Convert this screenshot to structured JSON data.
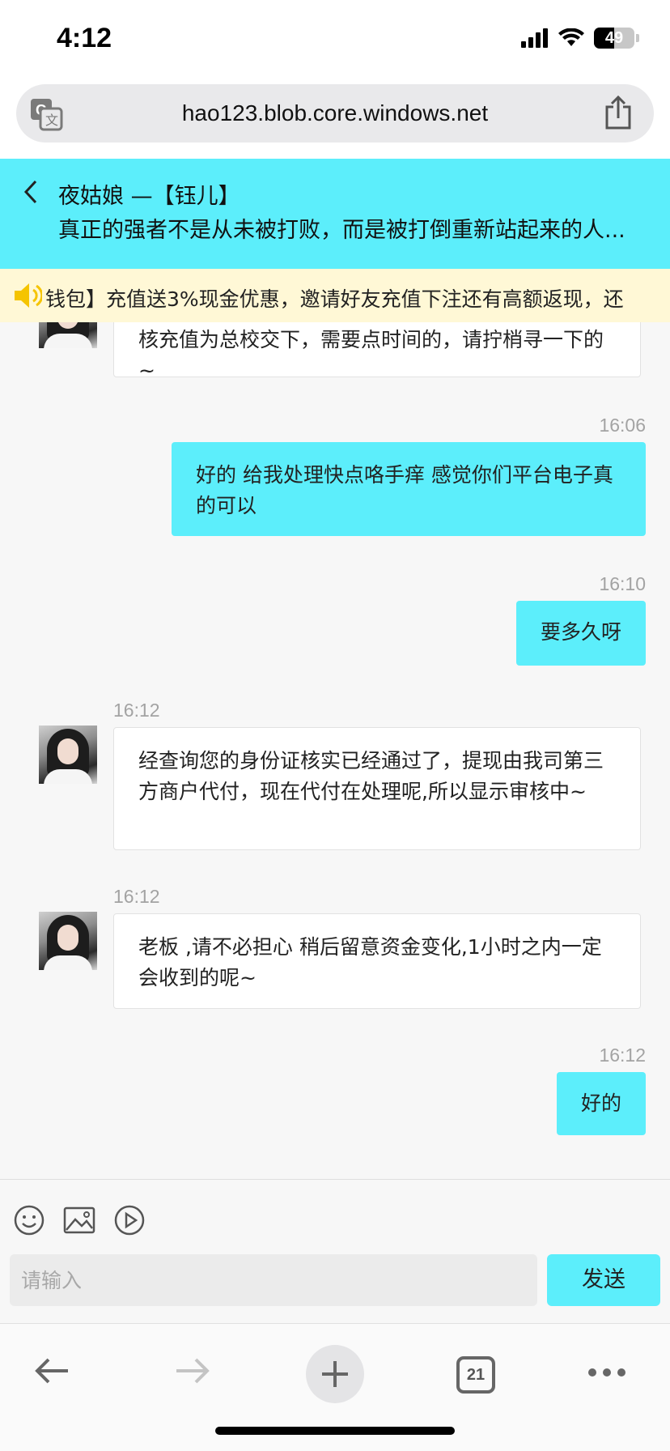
{
  "status": {
    "time": "4:12",
    "battery": "49"
  },
  "browser": {
    "url": "hao123.blob.core.windows.net",
    "tab_count": "21"
  },
  "chat_header": {
    "name": "夜姑娘 —【钰儿】",
    "motto": "真正的强者不是从未被打败，而是被打倒重新站起来的人..."
  },
  "notice": {
    "text": "钱包】充值送3%现金优惠，邀请好友充值下注还有高额返现，还"
  },
  "messages": [
    {
      "side": "in",
      "time": "",
      "text": "核充值为总校交下，需要点时间的，请拧梢寻一下的~"
    },
    {
      "side": "out",
      "time": "16:06",
      "text": "好的 给我处理快点咯手痒 感觉你们平台电子真的可以"
    },
    {
      "side": "out",
      "time": "16:10",
      "text": "要多久呀"
    },
    {
      "side": "in",
      "time": "16:12",
      "text": "经查询您的身份证核实已经通过了，提现由我司第三方商户代付，现在代付在处理呢,所以显示审核中~"
    },
    {
      "side": "in",
      "time": "16:12",
      "text": "老板 ,请不必担心 稍后留意资金变化,1小时之内一定会收到的呢~"
    },
    {
      "side": "out",
      "time": "16:12",
      "text": "好的"
    }
  ],
  "composer": {
    "placeholder": "请输入",
    "send_label": "发送"
  },
  "colors": {
    "accent": "#5ceefb",
    "notice_bg": "#fff8d6",
    "speaker": "#f5c400"
  }
}
